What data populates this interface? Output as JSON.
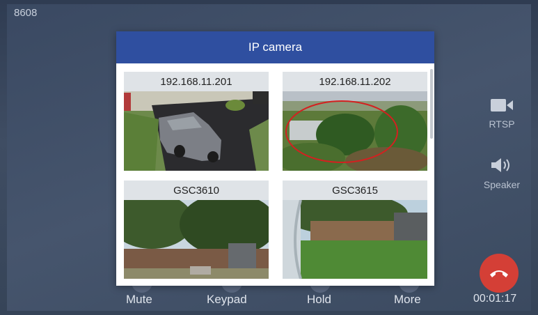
{
  "screen": {
    "extension": "8608",
    "timer": "00:01:17"
  },
  "dialog": {
    "title": "IP camera",
    "cameras": [
      {
        "label": "192.168.11.201"
      },
      {
        "label": "192.168.11.202"
      },
      {
        "label": "GSC3610"
      },
      {
        "label": "GSC3615"
      }
    ]
  },
  "side_controls": {
    "rtsp_label": "RTSP",
    "rtsp_icon": "video-camera-icon",
    "speaker_label": "Speaker",
    "speaker_icon": "speaker-icon",
    "hangup_icon": "phone-hangup-icon"
  },
  "bottom_controls": {
    "mute": "Mute",
    "keypad": "Keypad",
    "hold": "Hold",
    "more": "More"
  },
  "colors": {
    "header": "#2f4fa0",
    "hangup": "#d43f36",
    "highlight_circle": "#d42020"
  }
}
